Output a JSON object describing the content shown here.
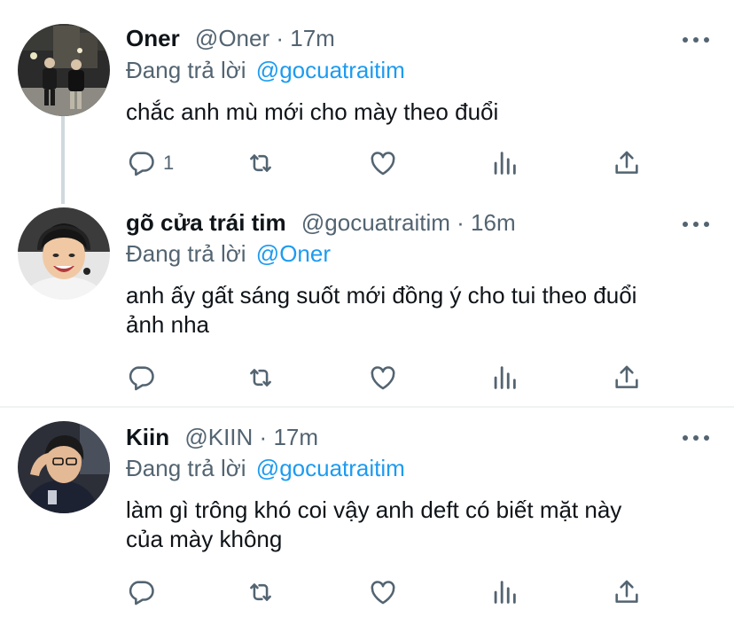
{
  "tweets": [
    {
      "name": "Oner",
      "handle": "@Oner",
      "time": "17m",
      "reply_prefix": "Đang trả lời",
      "reply_to": "@gocuatraitim",
      "text": "chắc anh mù mới cho mày theo đuổi",
      "reply_count": "1",
      "avatar": "night-street-photo"
    },
    {
      "name": "gõ cửa trái tim",
      "handle": "@gocuatraitim",
      "time": "16m",
      "reply_prefix": "Đang trả lời",
      "reply_to": "@Oner",
      "text_line1": "anh ấy gất sáng suốt mới đồng ý cho tui theo đuổi",
      "text_line2": "ảnh nha",
      "reply_count": "",
      "avatar": "smiling-person-headset"
    },
    {
      "name": "Kiin",
      "handle": "@KIIN",
      "time": "17m",
      "reply_prefix": "Đang trả lời",
      "reply_to": "@gocuatraitim",
      "text_line1": "làm gì trông khó coi vậy anh deft có biết mặt này",
      "text_line2": "của mày không",
      "reply_count": "",
      "avatar": "person-with-glasses"
    }
  ],
  "dot_separator": "·",
  "icons": [
    "reply-icon",
    "retweet-icon",
    "like-icon",
    "analytics-icon",
    "share-icon",
    "more-icon"
  ],
  "colors": {
    "link": "#1d9bf0",
    "secondary": "#536471",
    "text": "#0f1419",
    "thread_line": "#cfd9de"
  }
}
